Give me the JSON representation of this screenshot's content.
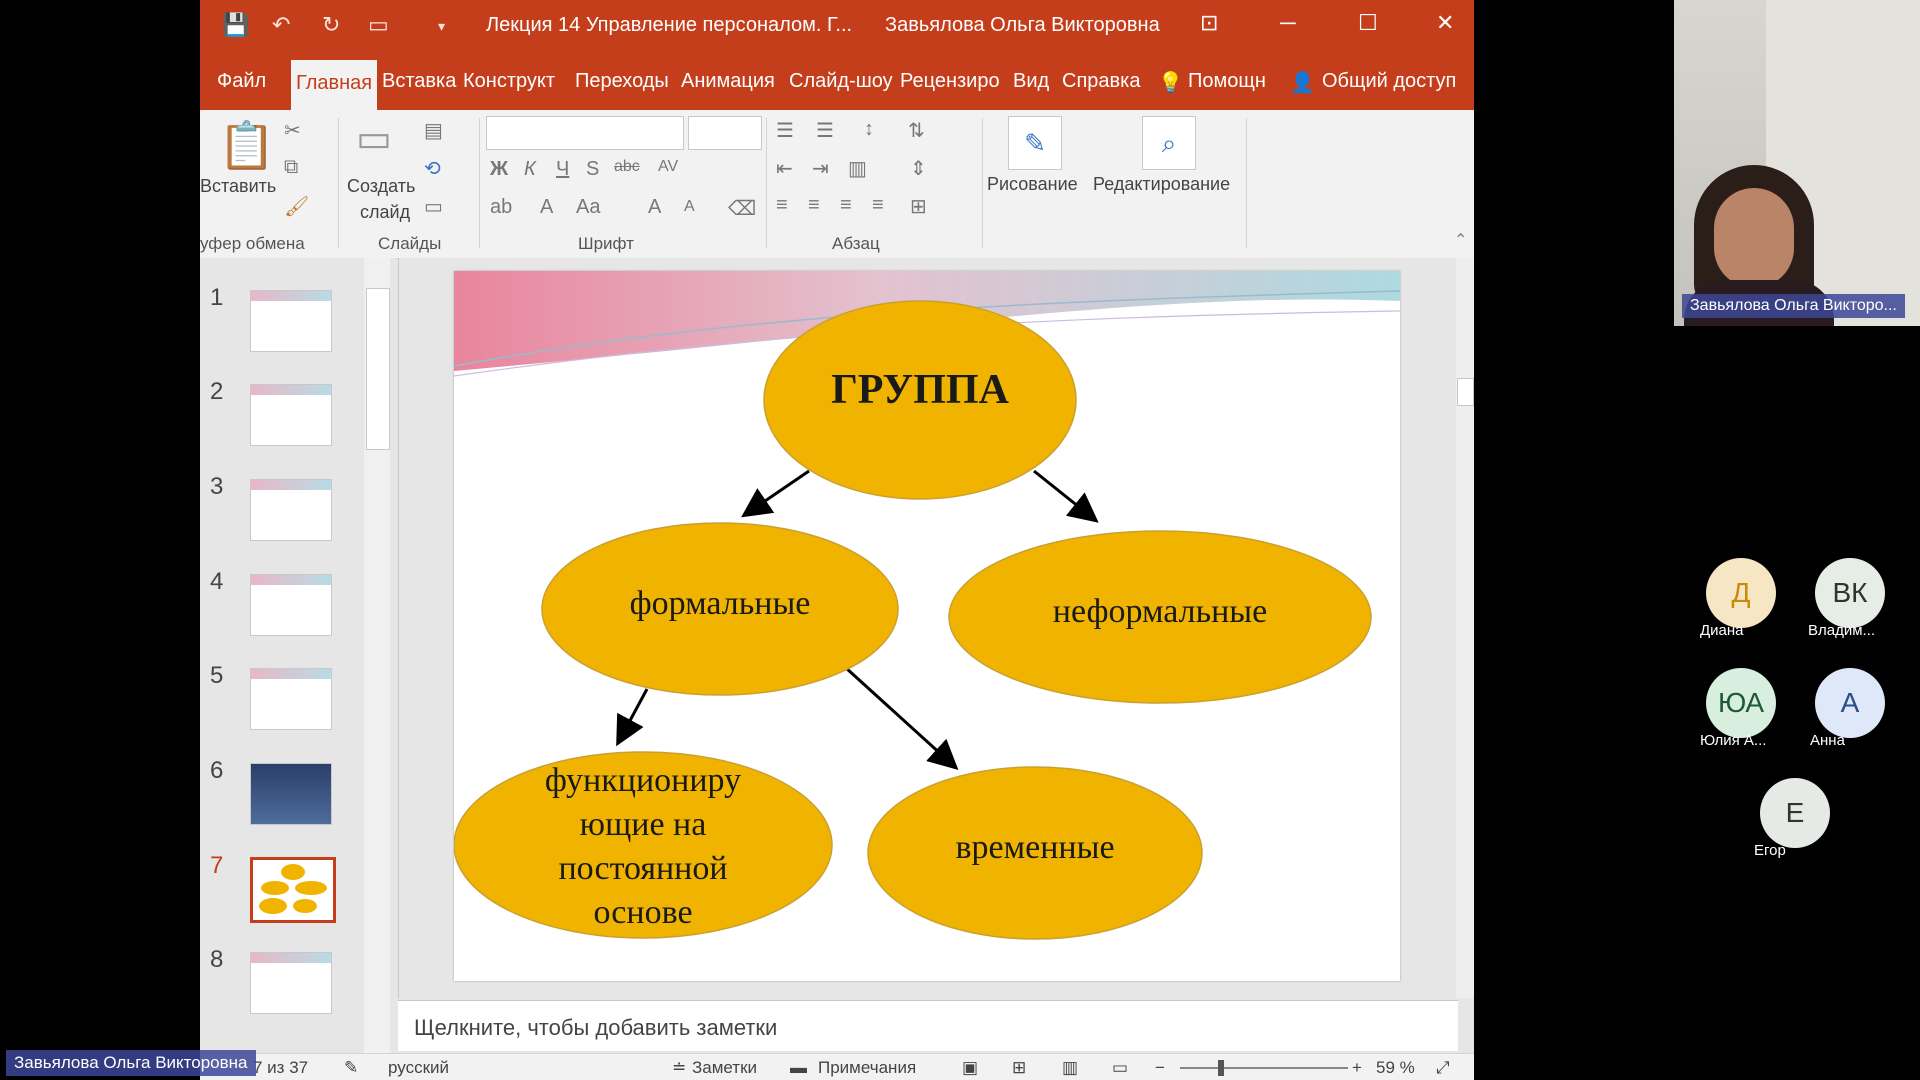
{
  "window": {
    "title": "Лекция 14 Управление персоналом. Г...",
    "owner": "Завьялова Ольга Викторовна"
  },
  "tabs": [
    "Файл",
    "Главная",
    "Вставка",
    "Конструкт",
    "Переходы",
    "Анимация",
    "Слайд-шоу",
    "Рецензиро",
    "Вид",
    "Справка"
  ],
  "tell_me": "Помощн",
  "share": "Общий доступ",
  "ribbon": {
    "paste": "Вставить",
    "new_slide_1": "Создать",
    "new_slide_2": "слайд",
    "drawing": "Рисование",
    "editing": "Редактирование",
    "groups": {
      "clipboard": "уфер обмена",
      "slides": "Слайды",
      "font": "Шрифт",
      "paragraph": "Абзац"
    }
  },
  "thumbnails": [
    "1",
    "2",
    "3",
    "4",
    "5",
    "6",
    "7",
    "8"
  ],
  "active_slide": 7,
  "slide": {
    "root": "ГРУППА",
    "formal": "формальные",
    "informal": "неформальные",
    "permanent": "функциониру ющие на постоянной основе",
    "temporary": "временные",
    "ellipse_color": "#f0b400"
  },
  "notes_placeholder": "Щелкните, чтобы добавить заметки",
  "status": {
    "slide_of": "7 из 37",
    "language": "русский",
    "notes": "Заметки",
    "comments": "Примечания",
    "zoom": "59 %"
  },
  "presenter": {
    "name_short": "Завьялова Ольга Викторо...",
    "name_full": "Завьялова Ольга Викторовна"
  },
  "participants": [
    {
      "initials": "Д",
      "name": "Диана"
    },
    {
      "initials": "ВК",
      "name": "Владим..."
    },
    {
      "initials": "ЮА",
      "name": "Юлия А..."
    },
    {
      "initials": "А",
      "name": "Анна"
    },
    {
      "initials": "Е",
      "name": "Егор"
    }
  ],
  "colors": {
    "accent": "#c43e1c"
  }
}
